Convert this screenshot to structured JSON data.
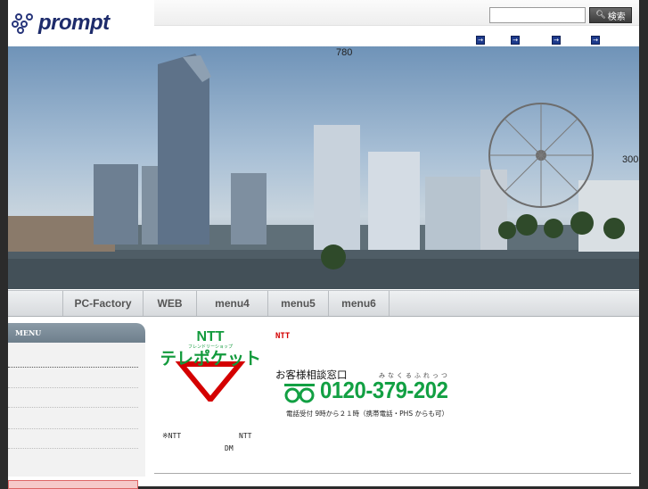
{
  "brand": {
    "name": "prompt"
  },
  "search": {
    "button_label": "検索",
    "input_value": ""
  },
  "quick_links": [
    "→",
    "→",
    "→",
    "→"
  ],
  "hero": {
    "label_width": "780",
    "label_height": "300"
  },
  "nav": {
    "items": [
      "PC-Factory",
      "WEB",
      "menu4",
      "menu5",
      "menu6"
    ]
  },
  "sidebar": {
    "menu_title": "MENU"
  },
  "content": {
    "logo": {
      "ntt": "NTT",
      "sub": "フレンドリーショップ",
      "name": "テレポケット"
    },
    "ntt_label": "NTT",
    "consult_label": "お客様相談窓口",
    "phone_reading": "みなくるふれっつ",
    "phone_number": "0120-379-202",
    "hours": "電話受付 9時から２１時（携帯電話・PHS からも可）",
    "intro_line1": "※NTT",
    "intro_ntt2": "NTT",
    "intro_dm": "DM"
  },
  "colors": {
    "accent_green": "#12a043",
    "ntt_red": "#d40000",
    "nav_bg": "#dcdfe2",
    "menu_header": "#7d8d99"
  }
}
